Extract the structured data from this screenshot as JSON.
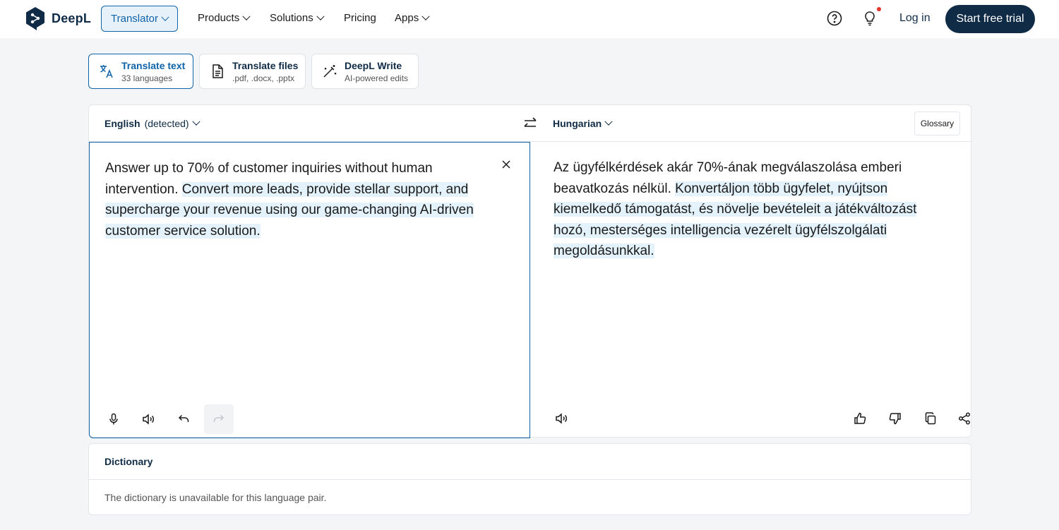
{
  "brand": {
    "name": "DeepL"
  },
  "nav": {
    "translator": "Translator",
    "items": [
      "Products",
      "Solutions",
      "Pricing",
      "Apps"
    ],
    "login": "Log in",
    "trial": "Start free trial"
  },
  "modes": [
    {
      "title": "Translate text",
      "subtitle": "33 languages",
      "icon": "translate-icon"
    },
    {
      "title": "Translate files",
      "subtitle": ".pdf, .docx, .pptx",
      "icon": "file-icon"
    },
    {
      "title": "DeepL Write",
      "subtitle": "AI-powered edits",
      "icon": "magic-wand-icon"
    }
  ],
  "translator": {
    "source_lang": "English",
    "source_detected": "(detected)",
    "target_lang": "Hungarian",
    "glossary": "Glossary",
    "source_text_a": "Answer up to 70% of customer inquiries without human intervention. ",
    "source_text_b": "Convert more leads, provide stellar support, and supercharge your revenue using our game-changing AI-driven customer service solution.",
    "target_text_a": "Az ügyfélkérdések akár 70%-ának megválaszolása emberi beavatkozás nélkül. ",
    "target_text_b": "Konvertáljon több ügyfelet, nyújtson kiemelkedő támogatást, és növelje bevételeit a játékváltozást hozó, mesterséges intelligencia vezérelt ügyfélszolgálati megoldásunkkal."
  },
  "dictionary": {
    "title": "Dictionary",
    "message": "The dictionary is unavailable for this language pair."
  },
  "colors": {
    "brand_navy": "#0f2b46",
    "accent_blue": "#0f63a8",
    "highlight": "#e4f2fb",
    "notification": "#e0362c"
  }
}
